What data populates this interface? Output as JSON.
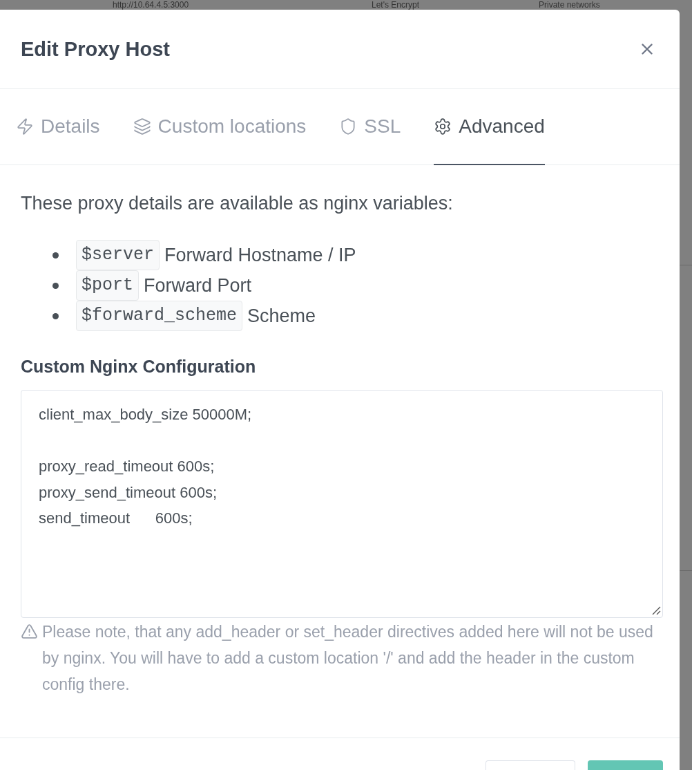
{
  "background_table": {
    "cells": [
      "http://10.64.4.5:3000",
      "Let's Encrypt",
      "Private networks"
    ]
  },
  "modal": {
    "title": "Edit Proxy Host",
    "tabs": [
      {
        "label": "Details",
        "selected": false
      },
      {
        "label": "Custom locations",
        "selected": false
      },
      {
        "label": "SSL",
        "selected": false
      },
      {
        "label": "Advanced",
        "selected": true
      }
    ],
    "intro": "These proxy details are available as nginx variables:",
    "variables": [
      {
        "code": "$server",
        "description": "Forward Hostname / IP"
      },
      {
        "code": "$port",
        "description": "Forward Port"
      },
      {
        "code": "$forward_scheme",
        "description": "Scheme"
      }
    ],
    "config_label": "Custom Nginx Configuration",
    "config_value": "client_max_body_size 50000M;\n\nproxy_read_timeout 600s;\nproxy_send_timeout 600s;\nsend_timeout      600s;",
    "note": "Please note, that any add_header or set_header directives added here will not be used by nginx. You will have to add a custom location '/' and add the header in the custom config there.",
    "footer_buttons": [
      {
        "kind": "secondary"
      },
      {
        "kind": "primary"
      }
    ]
  }
}
